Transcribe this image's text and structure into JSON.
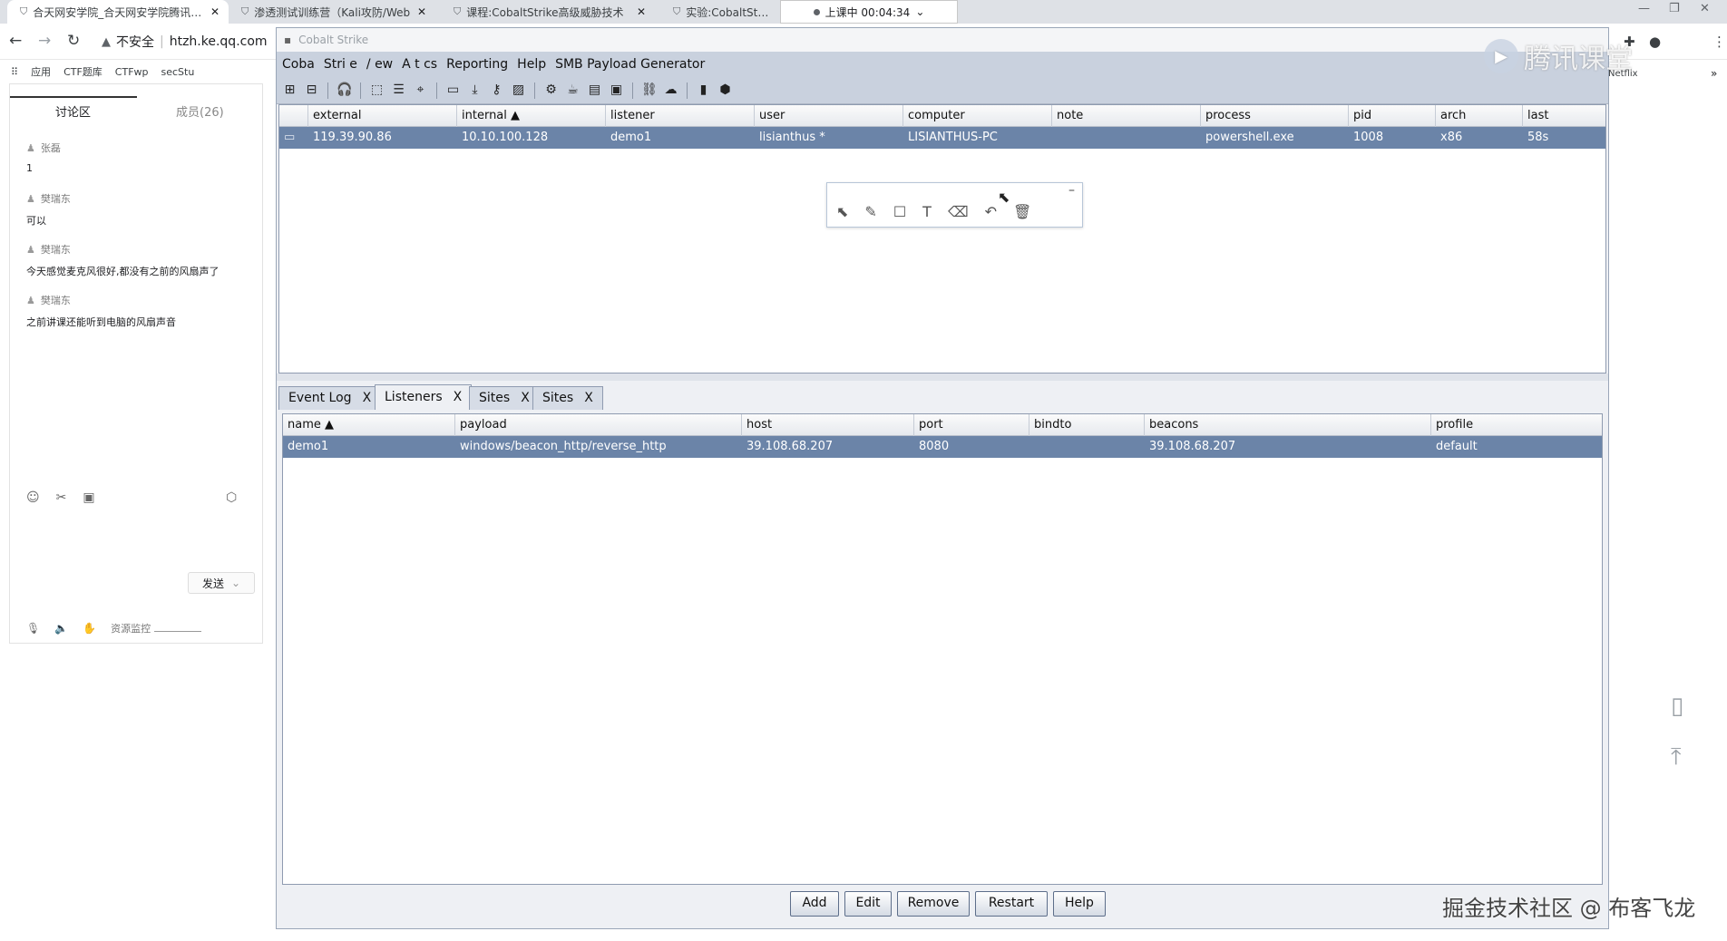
{
  "browser": {
    "tabs": [
      {
        "label": "合天网安学院_合天网安学院腾讯课堂",
        "close": "✕",
        "icon": "shield-icon"
      },
      {
        "label": "渗透测试训练营（Kali攻防/Web",
        "close": "✕",
        "icon": "shield-icon"
      },
      {
        "label": "课程:CobaltStrike高级威胁技术",
        "close": "✕",
        "icon": "shield-icon"
      },
      {
        "label": "实验:CobaltStrike",
        "close": "",
        "icon": "shield-icon"
      }
    ],
    "recording": "上课中 00:04:34",
    "recording_chevron": "⌄",
    "address_security": "不安全",
    "address_url": "htzh.ke.qq.com",
    "bookmarks": [
      "应用",
      "CTF题库",
      "CTFwp",
      "secStu"
    ],
    "bookmark_right": "Netflix"
  },
  "chat": {
    "tab_discussion": "讨论区",
    "tab_members": "成员(26)",
    "messages": [
      {
        "user": "张磊",
        "text": "1"
      },
      {
        "user": "樊瑞东",
        "text": "可以"
      },
      {
        "user": "樊瑞东",
        "text": "今天感觉麦克风很好,都没有之前的风扇声了"
      },
      {
        "user": "樊瑞东",
        "text": "之前讲课还能听到电脑的风扇声音"
      }
    ],
    "send": "发送",
    "monitor": "资源监控"
  },
  "cobalt": {
    "title": "Cobalt Strike",
    "menu": [
      "Coba",
      "Stri e",
      "/ ew",
      "A  t cs",
      "Reporting",
      "Help",
      "SMB Payload Generator"
    ],
    "beacons": {
      "columns": [
        "external",
        "internal ▲",
        "listener",
        "user",
        "computer",
        "note",
        "process",
        "pid",
        "arch",
        "last"
      ],
      "rows": [
        [
          "119.39.90.86",
          "10.10.100.128",
          "demo1",
          "lisianthus *",
          "LISIANTHUS-PC",
          "",
          "powershell.exe",
          "1008",
          "x86",
          "58s"
        ]
      ]
    },
    "bottom_tabs": [
      {
        "label": "Event Log",
        "close": "X"
      },
      {
        "label": "Listeners",
        "close": "X"
      },
      {
        "label": "Sites",
        "close": "X"
      },
      {
        "label": "Sites",
        "close": "X"
      }
    ],
    "listeners": {
      "columns": [
        "name ▲",
        "payload",
        "host",
        "port",
        "bindto",
        "beacons",
        "profile"
      ],
      "rows": [
        [
          "demo1",
          "windows/beacon_http/reverse_http",
          "39.108.68.207",
          "8080",
          "",
          "39.108.68.207",
          "default"
        ]
      ]
    },
    "buttons": [
      "Add",
      "Edit",
      "Remove",
      "Restart",
      "Help"
    ]
  },
  "overlay": {
    "qq_brand": "腾讯课堂",
    "watermark": "掘金技术社区 @ 布客飞龙"
  }
}
